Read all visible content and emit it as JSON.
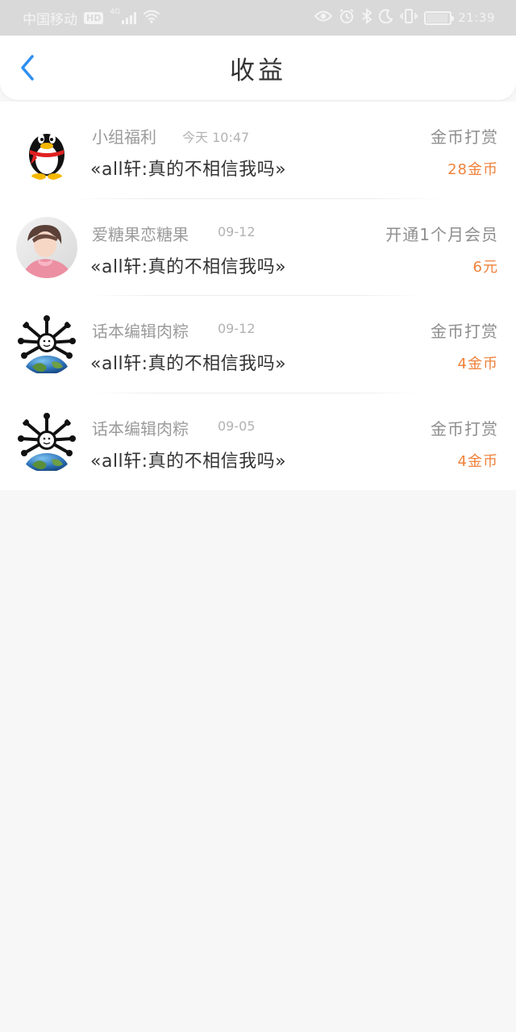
{
  "status_bar": {
    "carrier": "中国移动",
    "hd": "HD",
    "network": "4G",
    "time": "21:39"
  },
  "header": {
    "title": "收益",
    "back_icon": "chevron-left-icon"
  },
  "colors": {
    "accent_blue": "#2f8ff0",
    "amount_orange": "#f0813a"
  },
  "records": [
    {
      "name": "小组福利",
      "date": "今天 10:47",
      "content": "«all轩:真的不相信我吗»",
      "type": "金币打赏",
      "amount": "28金币",
      "avatar": "penguin-avatar"
    },
    {
      "name": "爱糖果恋糖果",
      "date": "09-12",
      "content": "«all轩:真的不相信我吗»",
      "type": "开通1个月会员",
      "amount": "6元",
      "avatar": "user-photo-avatar"
    },
    {
      "name": "话本编辑肉粽",
      "date": "09-12",
      "content": "«all轩:真的不相信我吗»",
      "type": "金币打赏",
      "amount": "4金币",
      "avatar": "globe-avatar"
    },
    {
      "name": "话本编辑肉粽",
      "date": "09-05",
      "content": "«all轩:真的不相信我吗»",
      "type": "金币打赏",
      "amount": "4金币",
      "avatar": "globe-avatar"
    }
  ]
}
